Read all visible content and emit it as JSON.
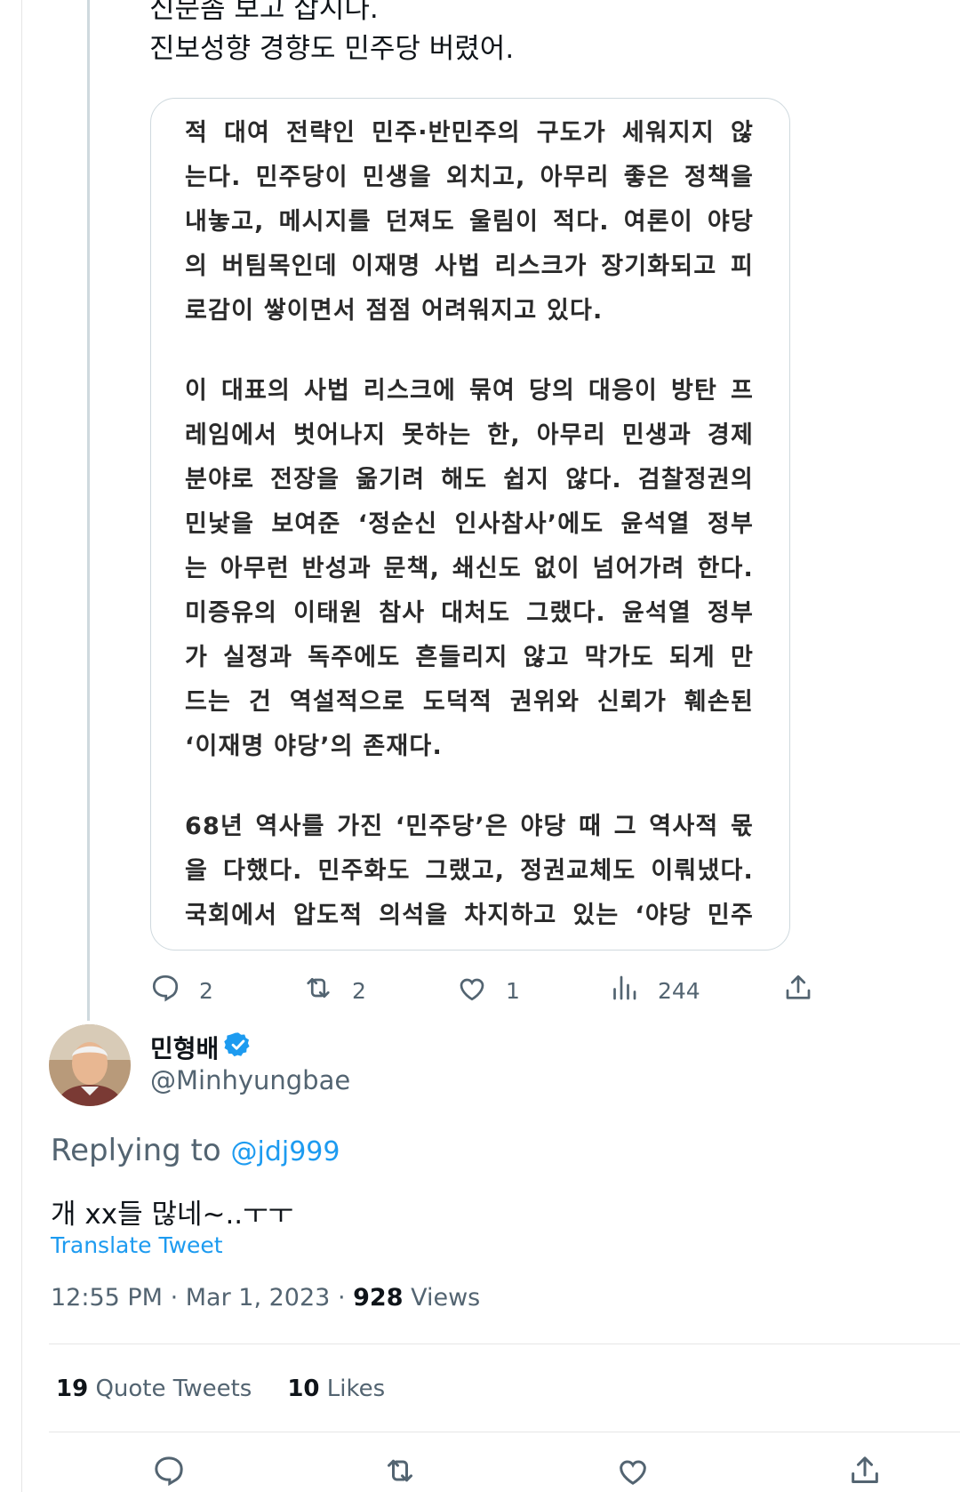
{
  "parent_tweet": {
    "lines": [
      "신문좀 보고 삽시다.",
      "진보성향 경향도 민주당 버렸어."
    ],
    "article_image": {
      "paragraphs": [
        [
          "적 대여 전략인 민주·반민주의 구도가 세워지지 않",
          "는다. 민주당이 민생을 외치고, 아무리 좋은 정책을",
          "내놓고, 메시지를 던져도 울림이 적다. 여론이 야당",
          "의 버팀목인데 이재명 사법 리스크가 장기화되고 피",
          "로감이 쌓이면서 점점 어려워지고 있다."
        ],
        [
          "이 대표의 사법 리스크에 묶여 당의 대응이 방탄 프",
          "레임에서 벗어나지 못하는 한, 아무리 민생과 경제",
          "분야로 전장을 옮기려 해도 쉽지 않다. 검찰정권의",
          "민낯을 보여준 ‘정순신 인사참사’에도 윤석열 정부",
          "는 아무런 반성과 문책, 쇄신도 없이 넘어가려 한다.",
          "미증유의 이태원 참사 대처도 그랬다. 윤석열 정부",
          "가 실정과 독주에도 흔들리지 않고 막가도 되게 만",
          "드는 건 역설적으로 도덕적 권위와 신뢰가 훼손된",
          "‘이재명 야당’의 존재다."
        ],
        [
          "68년 역사를 가진 ‘민주당’은 야당 때 그 역사적 몫",
          "을 다했다. 민주화도 그랬고, 정권교체도 이뤄냈다.",
          "국회에서 압도적 의석을 차지하고 있는 ‘야당 민주"
        ]
      ]
    },
    "actions": {
      "reply_count": "2",
      "retweet_count": "2",
      "like_count": "1",
      "views_count": "244"
    }
  },
  "main_tweet": {
    "display_name": "민형배",
    "handle": "@Minhyungbae",
    "verified": true,
    "replying_prefix": "Replying to",
    "replying_to": "@jdj999",
    "text": "개 xx들 많네~..ㅜㅜ",
    "translate_label": "Translate Tweet",
    "time": "12:55 PM",
    "date": "Mar 1, 2023",
    "separator": "·",
    "views_count": "928",
    "views_label": "Views",
    "quote_tweets_count": "19",
    "quote_tweets_label": "Quote Tweets",
    "likes_count": "10",
    "likes_label": "Likes"
  },
  "colors": {
    "accent": "#1d9bf0",
    "muted_text": "#536471",
    "primary_text": "#0f1419",
    "border": "#cfd9de"
  },
  "icons": [
    "reply-icon",
    "retweet-icon",
    "like-icon",
    "views-icon",
    "share-icon",
    "verified-badge-icon"
  ]
}
